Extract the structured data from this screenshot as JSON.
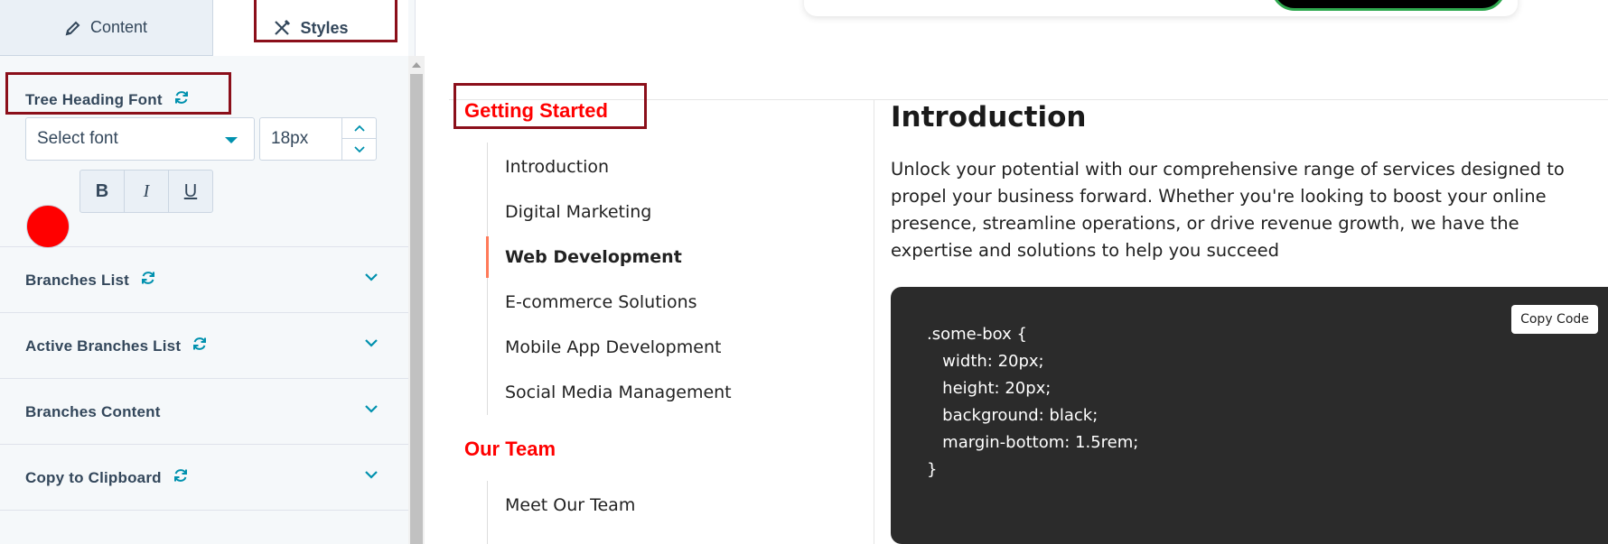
{
  "editor": {
    "tabs": [
      {
        "label": "Content",
        "icon": "pencil-icon"
      },
      {
        "label": "Styles",
        "icon": "styles-icon"
      }
    ],
    "tree_heading_font": {
      "title": "Tree Heading Font",
      "font_placeholder": "Select font",
      "font_size": "18px",
      "color": "#ff0000",
      "bold_label": "B",
      "italic_label": "I",
      "underline_label": "U"
    },
    "sections": [
      {
        "title": "Branches List",
        "has_sync_icon": true
      },
      {
        "title": "Active Branches List",
        "has_sync_icon": true
      },
      {
        "title": "Branches Content",
        "has_sync_icon": false
      },
      {
        "title": "Copy to Clipboard",
        "has_sync_icon": true
      }
    ]
  },
  "preview": {
    "groups": [
      {
        "title": "Getting Started",
        "items": [
          "Introduction",
          "Digital Marketing",
          "Web Development",
          "E-commerce Solutions",
          "Mobile App Development",
          "Social Media Management"
        ],
        "active": "Web Development"
      },
      {
        "title": "Our Team",
        "items": [
          "Meet Our Team"
        ]
      }
    ],
    "content": {
      "title": "Introduction",
      "body": "Unlock your potential with our comprehensive range of services designed to propel your business forward. Whether you're looking to boost your online presence, streamline operations, or drive revenue growth, we have the expertise and solutions to help you succeed",
      "code_lines": [
        ".some-box {",
        "   width: 20px;",
        "   height: 20px;",
        "   background: black;",
        "   margin-bottom: 1.5rem;",
        "}"
      ],
      "copy_button_label": "Copy Code"
    }
  },
  "colors": {
    "accent": "#0091ae",
    "group_title": "#ff0000",
    "annotation": "#8b0f1a",
    "active_marker": "#ff7a59"
  }
}
